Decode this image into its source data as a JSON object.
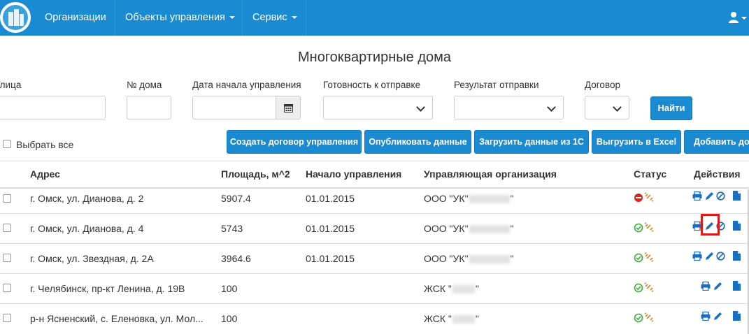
{
  "nav": {
    "items": [
      {
        "label": "Организации"
      },
      {
        "label": "Объекты управления"
      },
      {
        "label": "Сервис"
      }
    ]
  },
  "title": "Многоквартирные дома",
  "filters": {
    "street_label": "Улица",
    "house_label": "№ дома",
    "date_label": "Дата начала управления",
    "ready_label": "Готовность к отправке",
    "result_label": "Результат отправки",
    "contract_label": "Договор",
    "find_button": "Найти"
  },
  "select_all_label": "Выбрать все",
  "actions": {
    "create_contract": "Создать договор управления",
    "publish": "Опубликовать данные",
    "load_1c": "Загрузить данные из 1С",
    "export_excel": "Выгрузить в Excel",
    "add": "Добавить дом"
  },
  "table": {
    "headers": {
      "address": "Адрес",
      "area": "Площадь, м^2",
      "start": "Начало управления",
      "org": "Управляющая организация",
      "status": "Статус",
      "actions": "Действия"
    },
    "rows": [
      {
        "address": "г. Омск, ул. Дианова, д. 2",
        "area": "5907.4",
        "start": "01.01.2015",
        "org_prefix": "ООО \"УК\"",
        "org_suffix": "\"",
        "status": "error"
      },
      {
        "address": "г. Омск, ул. Дианова, д. 4",
        "area": "5743",
        "start": "01.01.2015",
        "org_prefix": "ООО \"УК\"",
        "org_suffix": "\"",
        "status": "ok"
      },
      {
        "address": "г. Омск, ул. Звездная, д. 2А",
        "area": "3964.6",
        "start": "01.01.2015",
        "org_prefix": "ООО \"УК\"",
        "org_suffix": "\"",
        "status": "ok"
      },
      {
        "address": "г. Челябинск, пр-кт Ленина, д. 19В",
        "area": "100",
        "start": "",
        "org_prefix": "ЖСК \"",
        "org_suffix": "\"",
        "status": "ok"
      },
      {
        "address": "р-н Ясненский, с. Еленовка, ул. Мол...",
        "area": "100",
        "start": "",
        "org_prefix": "ЖСК \"",
        "org_suffix": "\"",
        "status": "ok"
      }
    ]
  },
  "colors": {
    "brand": "#1a8ad3",
    "ok": "#3cae3c",
    "error": "#d9261c",
    "link": "#e08a2a",
    "highlight": "#e01b1b"
  }
}
